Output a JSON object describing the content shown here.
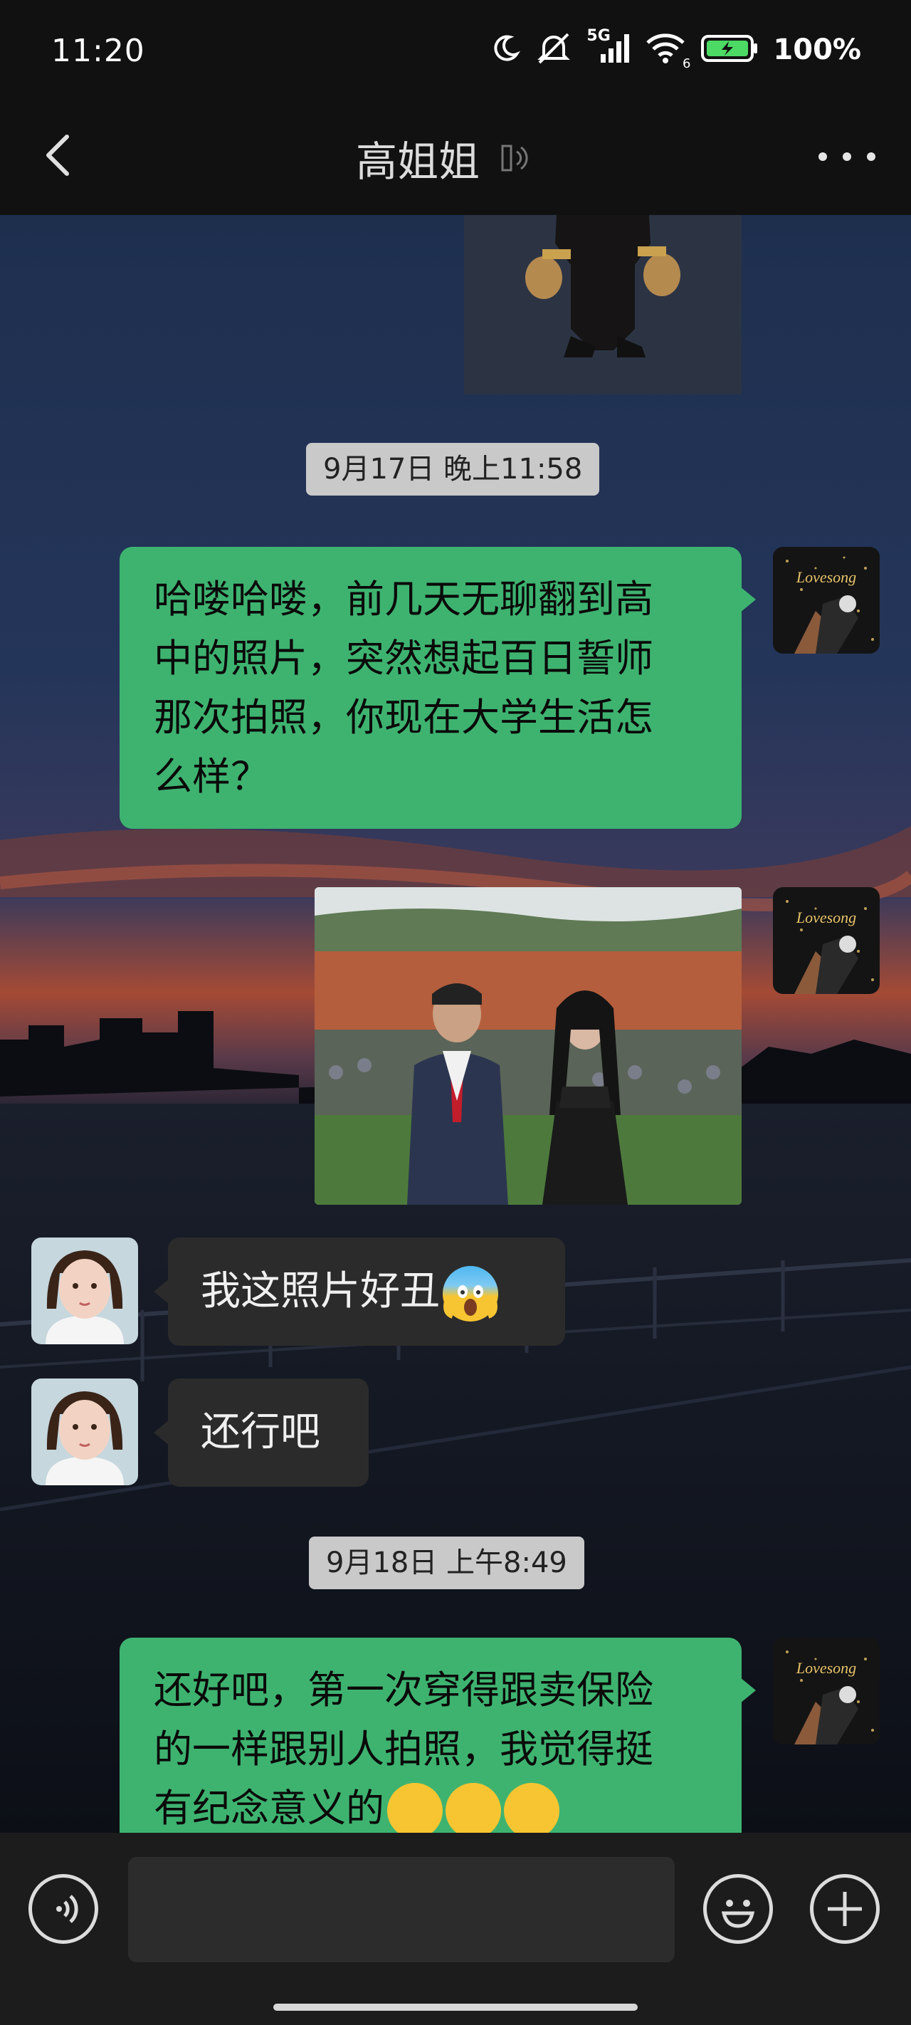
{
  "status_bar": {
    "time": "11:20",
    "network": "5G",
    "wifi_sub": "6",
    "battery": "100%",
    "icons": [
      "moon-icon",
      "mute-icon",
      "signal-icon",
      "wifi-icon",
      "battery-icon"
    ]
  },
  "header": {
    "title": "高姐姐",
    "icons": [
      "back-arrow-icon",
      "voice-mode-icon",
      "more-icon"
    ]
  },
  "messages": [
    {
      "type": "image",
      "side": "out",
      "content": "photo of a figurine"
    },
    {
      "type": "timestamp",
      "text": "9月17日 晚上11:58"
    },
    {
      "type": "text",
      "side": "out",
      "avatar_text": "Lovesong",
      "lines": [
        "哈喽哈喽，前几天无聊翻到高",
        "中的照片，突然想起百日誓师",
        "那次拍照，你现在大学生活怎",
        "么样？"
      ]
    },
    {
      "type": "image",
      "side": "out",
      "avatar_text": "Lovesong",
      "content": "photo of two people at an event"
    },
    {
      "type": "text",
      "side": "in",
      "text": "我这照片好丑",
      "emoji": "scream-emoji"
    },
    {
      "type": "text",
      "side": "in",
      "text": "还行吧"
    },
    {
      "type": "timestamp",
      "text": "9月18日 上午8:49"
    },
    {
      "type": "text",
      "side": "out",
      "avatar_text": "Lovesong",
      "lines": [
        "还好吧，第一次穿得跟卖保险",
        "的一样跟别人拍照，我觉得挺",
        "有纪念意义的"
      ],
      "emoji": [
        "grin-emoji",
        "grin-emoji",
        "grin-emoji"
      ]
    }
  ],
  "input_bar": {
    "icons": [
      "voice-input-icon",
      "emoji-icon",
      "plus-icon"
    ],
    "placeholder": ""
  },
  "colors": {
    "bubble_out": "#3eb370",
    "bubble_in": "#2b2b2b",
    "bar_bg": "#111111"
  }
}
